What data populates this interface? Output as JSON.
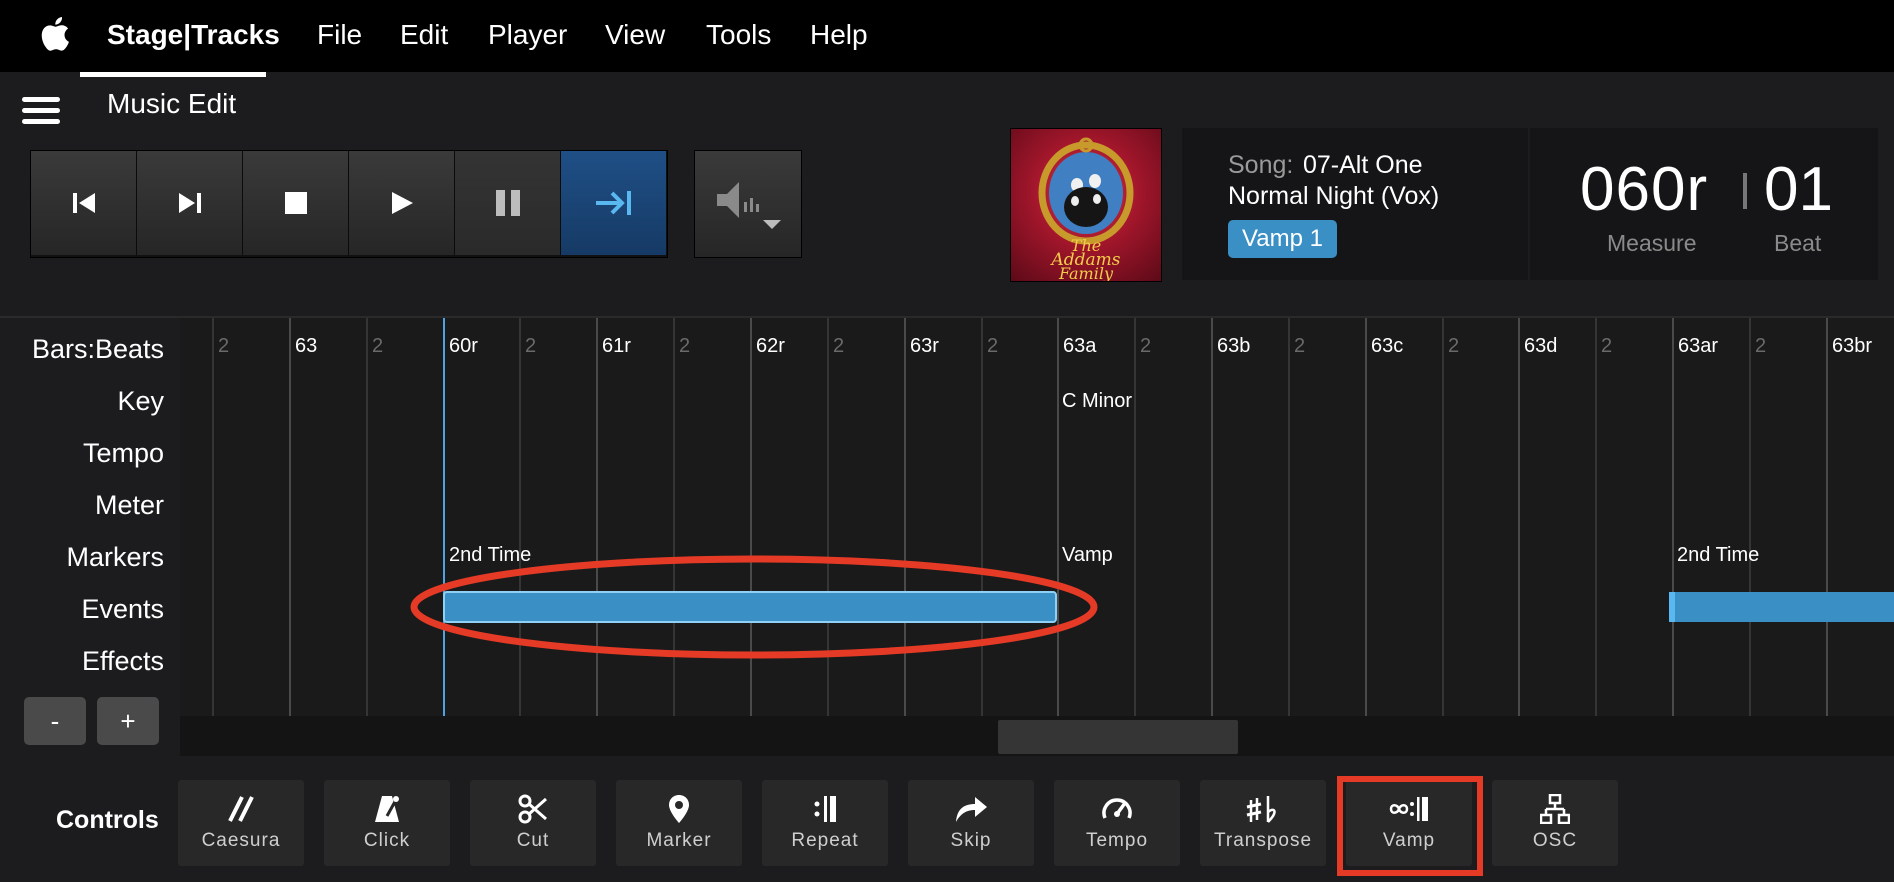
{
  "menubar": {
    "app_name": "Stage|Tracks",
    "items": [
      "File",
      "Edit",
      "Player",
      "View",
      "Tools",
      "Help"
    ]
  },
  "header": {
    "view_title": "Music Edit"
  },
  "transport": {
    "buttons": [
      "skip-back",
      "skip-forward",
      "stop",
      "play",
      "pause",
      "continue"
    ],
    "active": "continue"
  },
  "album": {
    "title_line1": "The",
    "title_line2": "Addams",
    "title_line3": "Family"
  },
  "song": {
    "label": "Song:",
    "name": "07-Alt One",
    "subtitle": "Normal Night (Vox)",
    "section_badge": "Vamp  1"
  },
  "position": {
    "measure": "060r",
    "beat": "01",
    "measure_label": "Measure",
    "beat_label": "Beat"
  },
  "tracks": [
    "Bars:Beats",
    "Key",
    "Tempo",
    "Meter",
    "Markers",
    "Events",
    "Effects"
  ],
  "timeline": {
    "ruler": [
      {
        "label": "2",
        "sub": true
      },
      {
        "label": "63",
        "sub": false
      },
      {
        "label": "2",
        "sub": true
      },
      {
        "label": "60r",
        "sub": false
      },
      {
        "label": "2",
        "sub": true
      },
      {
        "label": "61r",
        "sub": false
      },
      {
        "label": "2",
        "sub": true
      },
      {
        "label": "62r",
        "sub": false
      },
      {
        "label": "2",
        "sub": true
      },
      {
        "label": "63r",
        "sub": false
      },
      {
        "label": "2",
        "sub": true
      },
      {
        "label": "63a",
        "sub": false
      },
      {
        "label": "2",
        "sub": true
      },
      {
        "label": "63b",
        "sub": false
      },
      {
        "label": "2",
        "sub": true
      },
      {
        "label": "63c",
        "sub": false
      },
      {
        "label": "2",
        "sub": true
      },
      {
        "label": "63d",
        "sub": false
      },
      {
        "label": "2",
        "sub": true
      },
      {
        "label": "63ar",
        "sub": false
      },
      {
        "label": "2",
        "sub": true
      },
      {
        "label": "63br",
        "sub": false
      }
    ],
    "key_change": "C Minor",
    "markers": [
      "2nd Time",
      "Vamp",
      "2nd Time"
    ],
    "zoom_out": "-",
    "zoom_in": "+",
    "colors": {
      "event": "#3a8fc5",
      "playhead": "#4ea3e0",
      "annotation": "#e43a26"
    }
  },
  "controls": {
    "label": "Controls",
    "items": [
      {
        "label": "Caesura",
        "icon": "caesura-icon"
      },
      {
        "label": "Click",
        "icon": "metronome-icon"
      },
      {
        "label": "Cut",
        "icon": "scissors-icon"
      },
      {
        "label": "Marker",
        "icon": "location-pin-icon"
      },
      {
        "label": "Repeat",
        "icon": "repeat-sign-icon"
      },
      {
        "label": "Skip",
        "icon": "skip-arrow-icon"
      },
      {
        "label": "Tempo",
        "icon": "gauge-icon"
      },
      {
        "label": "Transpose",
        "icon": "sharp-flat-icon"
      },
      {
        "label": "Vamp",
        "icon": "vamp-loop-icon"
      },
      {
        "label": "OSC",
        "icon": "network-icon"
      }
    ],
    "highlighted": "Vamp"
  }
}
